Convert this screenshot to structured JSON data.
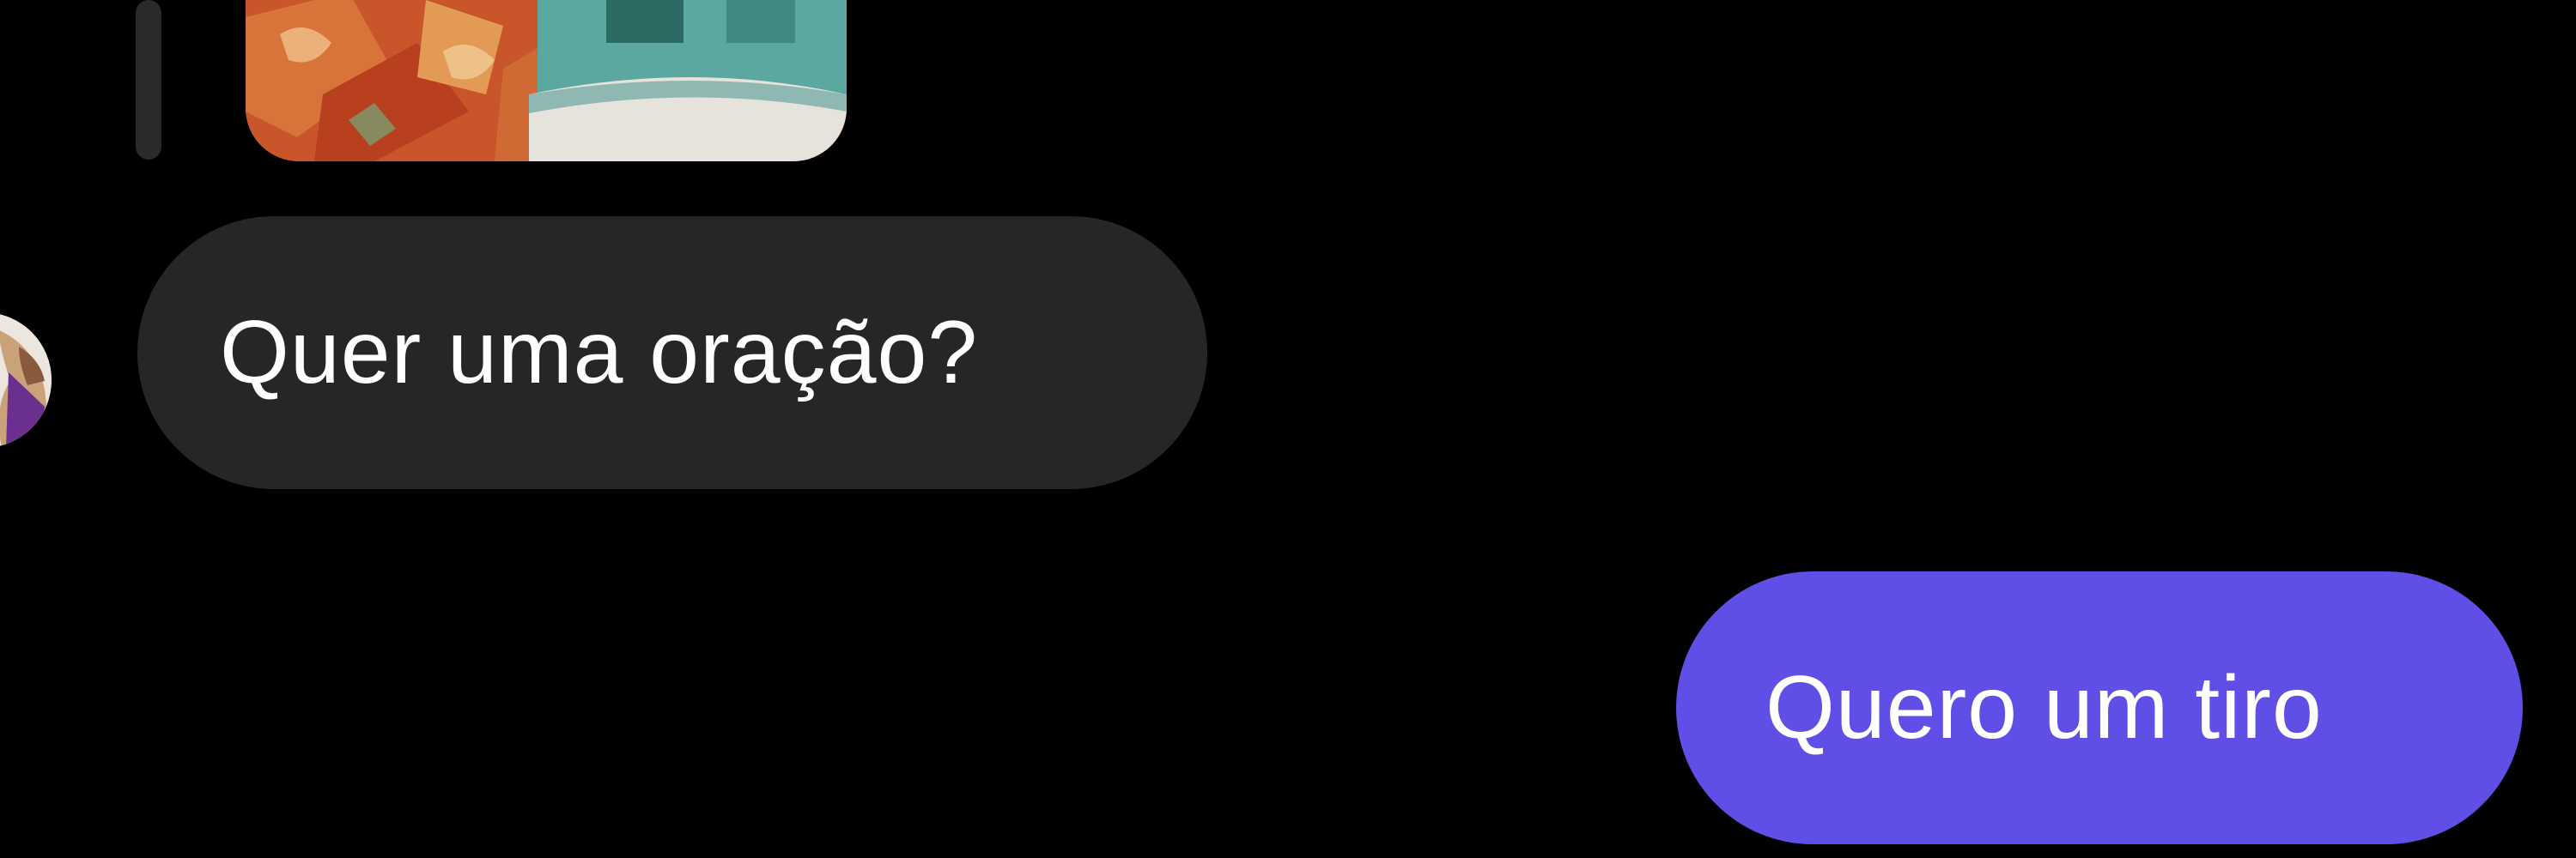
{
  "conversation": {
    "shared_media": {
      "icon": "media-thumbnail"
    },
    "incoming_message": {
      "text": "Quer uma oração?",
      "bubble_color": "#262626",
      "sender_avatar_icon": "avatar"
    },
    "outgoing_message": {
      "text": "Quero um tiro",
      "bubble_color": "#5f4fe6"
    }
  },
  "theme": {
    "background": "#000000",
    "text_color": "#ffffff"
  }
}
